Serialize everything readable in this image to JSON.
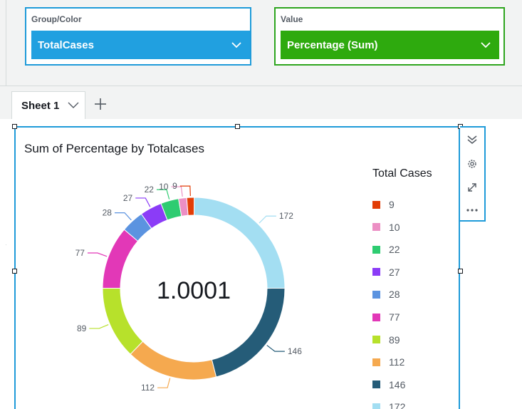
{
  "field_wells": {
    "group": {
      "label": "Group/Color",
      "field": "TotalCases"
    },
    "value": {
      "label": "Value",
      "field": "Percentage (Sum)"
    }
  },
  "tabs": [
    {
      "label": "Sheet 1"
    }
  ],
  "visual": {
    "title": "Sum of Percentage by Totalcases",
    "center_value": "1.0001",
    "legend_title": "Total Cases"
  },
  "colors": {
    "group_well": "#21a0e0",
    "value_well": "#2eaa0e",
    "selection": "#1f9bd9"
  },
  "icons": [
    "chevron-down-icon",
    "plus-icon",
    "collapse-icon",
    "gear-icon",
    "expand-icon",
    "more-icon"
  ],
  "chart_data": {
    "type": "pie",
    "title": "Sum of Percentage by Totalcases",
    "donut": true,
    "center_label": "1.0001",
    "legend_title": "Total Cases",
    "categories": [
      "9",
      "10",
      "22",
      "27",
      "28",
      "77",
      "89",
      "112",
      "146",
      "172"
    ],
    "values": [
      9,
      10,
      22,
      27,
      28,
      77,
      89,
      112,
      146,
      172
    ],
    "colors": [
      "#e23d06",
      "#ec8fc4",
      "#2ecc71",
      "#8b3cf7",
      "#5b93e0",
      "#e238b7",
      "#b7e12b",
      "#f5a94f",
      "#255c78",
      "#a3def2"
    ]
  }
}
